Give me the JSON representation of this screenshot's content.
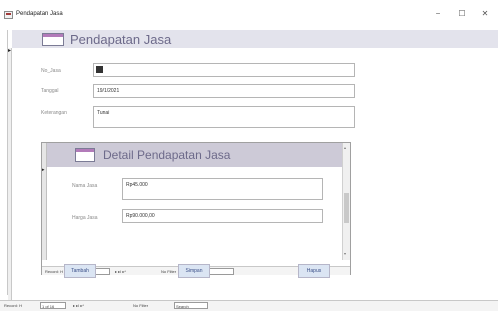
{
  "window": {
    "title": "Pendapatan Jasa",
    "minimize": "−",
    "maximize": "☐",
    "close": "✕"
  },
  "header": {
    "title": "Pendapatan Jasa"
  },
  "fields": {
    "no_jasa": {
      "label": "No_Jasa"
    },
    "tanggal": {
      "label": "Tanggal",
      "value": "19/1/2021"
    },
    "keterangan": {
      "label": "Keterangan",
      "value": "Tunai"
    }
  },
  "subform": {
    "title": "Detail Pendapatan Jasa",
    "nama_jasa": {
      "label": "Nama Jasa",
      "value": "Rp45.000"
    },
    "harga_jasa": {
      "label": "Harga Jasa",
      "value": "Rp90.000,00"
    },
    "nav": {
      "record_label": "Record: H",
      "position": "1 of 1",
      "arrows": "▸ ▸I ▸*",
      "filter": "No Filter",
      "search": "Search"
    }
  },
  "buttons": {
    "tambah": "Tambah",
    "simpan": "Simpan",
    "hapus": "Hapus"
  },
  "main_nav": {
    "record_label": "Record: H",
    "position": "1 of 16",
    "arrows": "▸ ▸I ▸*",
    "filter": "No Filter",
    "search": "Search"
  }
}
